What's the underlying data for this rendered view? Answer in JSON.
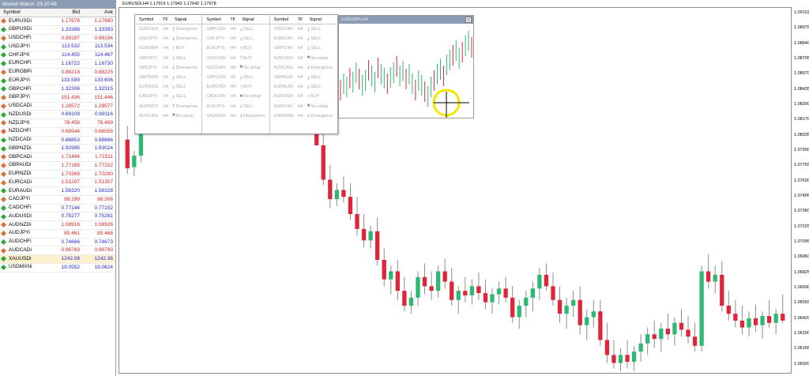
{
  "market_watch": {
    "title": "Market Watch: 23:20:49",
    "headers": {
      "symbol": "Symbol",
      "bid": "Bid",
      "ask": "Ask"
    },
    "rows": [
      {
        "symbol": "EURUSDi",
        "bid": "1.17678",
        "ask": "1.17680",
        "dir": "dn"
      },
      {
        "symbol": "GBPUSDi",
        "bid": "1.33388",
        "ask": "1.33393",
        "dir": "up"
      },
      {
        "symbol": "USDCHFi",
        "bid": "0.99187",
        "ask": "0.99194",
        "dir": "dn"
      },
      {
        "symbol": "USDJPYi",
        "bid": "113.532",
        "ask": "113.534",
        "dir": "up"
      },
      {
        "symbol": "CHFJPYi",
        "bid": "114.455",
        "ask": "114.467",
        "dir": "up"
      },
      {
        "symbol": "EURCHFi",
        "bid": "1.16722",
        "ask": "1.16730",
        "dir": "up"
      },
      {
        "symbol": "EURGBPi",
        "bid": "0.88218",
        "ask": "0.88225",
        "dir": "dn"
      },
      {
        "symbol": "EURJPYi",
        "bid": "133.599",
        "ask": "133.606",
        "dir": "up"
      },
      {
        "symbol": "GBPCHFi",
        "bid": "1.32306",
        "ask": "1.32315",
        "dir": "up"
      },
      {
        "symbol": "GBPJPYi",
        "bid": "151.436",
        "ask": "151.446",
        "dir": "dn"
      },
      {
        "symbol": "USDCADi",
        "bid": "1.28572",
        "ask": "1.28577",
        "dir": "dn"
      },
      {
        "symbol": "NZDUSDi",
        "bid": "0.69109",
        "ask": "0.69116",
        "dir": "up"
      },
      {
        "symbol": "NZDJPYi",
        "bid": "78.458",
        "ask": "78.469",
        "dir": "dn"
      },
      {
        "symbol": "NZDCHFi",
        "bid": "0.68544",
        "ask": "0.68556",
        "dir": "dn"
      },
      {
        "symbol": "NZDCADi",
        "bid": "0.88853",
        "ask": "0.88866",
        "dir": "up"
      },
      {
        "symbol": "GBPNZDi",
        "bid": "1.92995",
        "ask": "1.93024",
        "dir": "up"
      },
      {
        "symbol": "GBPCADi",
        "bid": "1.71494",
        "ask": "1.71511",
        "dir": "dn"
      },
      {
        "symbol": "GBPAUDi",
        "bid": "1.77185",
        "ask": "1.77202",
        "dir": "dn"
      },
      {
        "symbol": "EURNZDi",
        "bid": "1.70269",
        "ask": "1.70290",
        "dir": "dn"
      },
      {
        "symbol": "EURCADi",
        "bid": "1.51297",
        "ask": "1.51307",
        "dir": "dn"
      },
      {
        "symbol": "EURAUDi",
        "bid": "1.56320",
        "ask": "1.56328",
        "dir": "up"
      },
      {
        "symbol": "CADJPYi",
        "bid": "88.299",
        "ask": "88.306",
        "dir": "dn"
      },
      {
        "symbol": "CADCHFi",
        "bid": "0.77144",
        "ask": "0.77152",
        "dir": "up"
      },
      {
        "symbol": "AUDUSDi",
        "bid": "0.75277",
        "ask": "0.75281",
        "dir": "up"
      },
      {
        "symbol": "AUDNZDi",
        "bid": "1.08916",
        "ask": "1.08926",
        "dir": "dn"
      },
      {
        "symbol": "AUDJPYi",
        "bid": "85.461",
        "ask": "85.468",
        "dir": "dn"
      },
      {
        "symbol": "AUDCHFi",
        "bid": "0.74666",
        "ask": "0.74673",
        "dir": "up"
      },
      {
        "symbol": "AUDCADi",
        "bid": "0.96783",
        "ask": "0.96793",
        "dir": "dn"
      },
      {
        "symbol": "XAUUSDi",
        "bid": "1242.08",
        "ask": "1242.36",
        "dir": "up",
        "selected": true
      },
      {
        "symbol": "USDMXNi",
        "bid": "19.0552",
        "ask": "19.0624",
        "dir": "up"
      }
    ]
  },
  "chart": {
    "title": "EURUSDi,H4  1.17919 1.17942 1.17642 1.17678",
    "price_ticks": [
      "1.09110",
      "1.08975",
      "1.08840",
      "1.08705",
      "1.08570",
      "1.08435",
      "1.08300",
      "1.08170",
      "1.08035",
      "1.07900",
      "1.07765",
      "1.07630",
      "1.07495",
      "1.07360",
      "1.07225",
      "1.07095",
      "1.06960",
      "1.06825",
      "1.06690",
      "1.06555",
      "1.06420",
      "1.06290",
      "1.06155",
      "1.06020"
    ],
    "colors": {
      "bull": "#2db974",
      "bear": "#e0243a",
      "wick": "#8c8c8c"
    }
  },
  "chart_data": {
    "type": "candlestick",
    "title": "EURUSDi,H4",
    "ylim": [
      1.0595,
      1.0915
    ],
    "candles": [
      [
        1.08,
        1.0812,
        1.077,
        1.0775
      ],
      [
        1.0776,
        1.079,
        1.0768,
        1.0786
      ],
      [
        1.0786,
        1.0815,
        1.078,
        1.081
      ],
      [
        1.081,
        1.0832,
        1.0805,
        1.0828
      ],
      [
        1.0828,
        1.084,
        1.0815,
        1.082
      ],
      [
        1.082,
        1.0838,
        1.0812,
        1.0833
      ],
      [
        1.0833,
        1.0845,
        1.0825,
        1.083
      ],
      [
        1.083,
        1.085,
        1.0826,
        1.0842
      ],
      [
        1.0842,
        1.0855,
        1.083,
        1.0836
      ],
      [
        1.0836,
        1.0848,
        1.082,
        1.0824
      ],
      [
        1.0824,
        1.084,
        1.0815,
        1.0832
      ],
      [
        1.0832,
        1.0845,
        1.0822,
        1.0826
      ],
      [
        1.0826,
        1.0842,
        1.0818,
        1.0836
      ],
      [
        1.0836,
        1.085,
        1.0828,
        1.0845
      ],
      [
        1.0845,
        1.0852,
        1.083,
        1.0834
      ],
      [
        1.0834,
        1.0846,
        1.0824,
        1.084
      ],
      [
        1.084,
        1.0854,
        1.0832,
        1.0838
      ],
      [
        1.0838,
        1.0848,
        1.0826,
        1.083
      ],
      [
        1.083,
        1.0842,
        1.082,
        1.0836
      ],
      [
        1.0836,
        1.085,
        1.0828,
        1.0846
      ],
      [
        1.0846,
        1.086,
        1.0836,
        1.0842
      ],
      [
        1.0842,
        1.0852,
        1.083,
        1.0834
      ],
      [
        1.0834,
        1.0846,
        1.0824,
        1.084
      ],
      [
        1.084,
        1.0855,
        1.0832,
        1.085
      ],
      [
        1.085,
        1.0865,
        1.0842,
        1.0856
      ],
      [
        1.0856,
        1.0868,
        1.0838,
        1.0842
      ],
      [
        1.0842,
        1.0852,
        1.083,
        1.0835
      ],
      [
        1.0835,
        1.0845,
        1.0825,
        1.084
      ],
      [
        1.084,
        1.0852,
        1.08,
        1.0795
      ],
      [
        1.0795,
        1.0805,
        1.076,
        1.0765
      ],
      [
        1.0765,
        1.0778,
        1.074,
        1.0748
      ],
      [
        1.0748,
        1.0762,
        1.0742,
        1.0756
      ],
      [
        1.0756,
        1.0768,
        1.0745,
        1.075
      ],
      [
        1.075,
        1.0762,
        1.073,
        1.0735
      ],
      [
        1.0735,
        1.075,
        1.0716,
        1.0722
      ],
      [
        1.0722,
        1.0735,
        1.0706,
        1.0712
      ],
      [
        1.0712,
        1.0725,
        1.0705,
        1.072
      ],
      [
        1.072,
        1.0732,
        1.069,
        1.0695
      ],
      [
        1.0695,
        1.0705,
        1.0672,
        1.0678
      ],
      [
        1.0678,
        1.069,
        1.0665,
        1.0685
      ],
      [
        1.0685,
        1.0695,
        1.066,
        1.0668
      ],
      [
        1.0668,
        1.068,
        1.065,
        1.0655
      ],
      [
        1.0655,
        1.0668,
        1.0648,
        1.0662
      ],
      [
        1.0662,
        1.0685,
        1.0655,
        1.068
      ],
      [
        1.068,
        1.0692,
        1.0665,
        1.0672
      ],
      [
        1.0672,
        1.0685,
        1.066,
        1.0668
      ],
      [
        1.0668,
        1.069,
        1.0662,
        1.0685
      ],
      [
        1.0685,
        1.0696,
        1.067,
        1.0676
      ],
      [
        1.0676,
        1.0688,
        1.0655,
        1.066
      ],
      [
        1.066,
        1.0672,
        1.0648,
        1.0668
      ],
      [
        1.0668,
        1.068,
        1.0658,
        1.0664
      ],
      [
        1.0664,
        1.0678,
        1.0656,
        1.0672
      ],
      [
        1.0672,
        1.0684,
        1.066,
        1.0666
      ],
      [
        1.0666,
        1.0678,
        1.0652,
        1.0658
      ],
      [
        1.0658,
        1.067,
        1.0648,
        1.0665
      ],
      [
        1.0665,
        1.0676,
        1.0656,
        1.067
      ],
      [
        1.067,
        1.068,
        1.0658,
        1.0662
      ],
      [
        1.0662,
        1.0672,
        1.064,
        1.0645
      ],
      [
        1.0645,
        1.066,
        1.0635,
        1.0655
      ],
      [
        1.0655,
        1.0668,
        1.0645,
        1.0662
      ],
      [
        1.0662,
        1.0676,
        1.065,
        1.067
      ],
      [
        1.067,
        1.0688,
        1.066,
        1.0682
      ],
      [
        1.0682,
        1.0692,
        1.0668,
        1.0672
      ],
      [
        1.0672,
        1.0684,
        1.0655,
        1.066
      ],
      [
        1.066,
        1.0672,
        1.064,
        1.0648
      ],
      [
        1.0648,
        1.0662,
        1.0635,
        1.0655
      ],
      [
        1.0655,
        1.0668,
        1.0645,
        1.066
      ],
      [
        1.066,
        1.0672,
        1.063,
        1.0638
      ],
      [
        1.0638,
        1.0652,
        1.0625,
        1.0645
      ],
      [
        1.0645,
        1.066,
        1.0636,
        1.065
      ],
      [
        1.065,
        1.066,
        1.062,
        1.0625
      ],
      [
        1.0625,
        1.064,
        1.0605,
        1.0612
      ],
      [
        1.0612,
        1.0625,
        1.06,
        1.0605
      ],
      [
        1.0605,
        1.0618,
        1.0598,
        1.0612
      ],
      [
        1.0612,
        1.0625,
        1.06,
        1.0606
      ],
      [
        1.0606,
        1.062,
        1.0598,
        1.0615
      ],
      [
        1.0615,
        1.063,
        1.0606,
        1.0622
      ],
      [
        1.0622,
        1.0636,
        1.0612,
        1.063
      ],
      [
        1.063,
        1.0642,
        1.0618,
        1.0626
      ],
      [
        1.0626,
        1.064,
        1.0615,
        1.0635
      ],
      [
        1.0635,
        1.0648,
        1.0625,
        1.063
      ],
      [
        1.063,
        1.0645,
        1.062,
        1.064
      ],
      [
        1.064,
        1.0652,
        1.0628,
        1.0634
      ],
      [
        1.0634,
        1.0646,
        1.0622,
        1.0628
      ],
      [
        1.0628,
        1.064,
        1.0615,
        1.062
      ],
      [
        1.062,
        1.069,
        1.0615,
        1.0685
      ],
      [
        1.0685,
        1.07,
        1.067,
        1.0676
      ],
      [
        1.0676,
        1.069,
        1.0666,
        1.0682
      ],
      [
        1.0682,
        1.0694,
        1.065,
        1.0655
      ],
      [
        1.0655,
        1.0668,
        1.0642,
        1.0648
      ],
      [
        1.0648,
        1.066,
        1.0636,
        1.0642
      ],
      [
        1.0642,
        1.0655,
        1.063,
        1.0636
      ],
      [
        1.0636,
        1.065,
        1.0628,
        1.0644
      ],
      [
        1.0644,
        1.0656,
        1.0632,
        1.0638
      ],
      [
        1.0638,
        1.065,
        1.0626,
        1.0646
      ],
      [
        1.0646,
        1.066,
        1.0636,
        1.064
      ],
      [
        1.064,
        1.0652,
        1.063,
        1.0648
      ],
      [
        1.0648,
        1.0665,
        1.064,
        1.0642
      ]
    ]
  },
  "signals": {
    "headers": {
      "symbol": "Symbol",
      "tf": "TF",
      "signal": "Signal"
    },
    "columns": [
      [
        {
          "symbol": "EURUSDi",
          "tf": "H4",
          "arrow": "up-b",
          "signal": "Divergence"
        },
        {
          "symbol": "USDJPYi",
          "tf": "H4",
          "arrow": "dn-b",
          "signal": "Divergence"
        },
        {
          "symbol": "EURGBPi",
          "tf": "H4",
          "arrow": "up-g",
          "signal": "BUY"
        },
        {
          "symbol": "GBPJPYi",
          "tf": "H4",
          "arrow": "dn-r",
          "signal": "SELL"
        },
        {
          "symbol": "NZDJPYi",
          "tf": "H4",
          "arrow": "dn-b",
          "signal": "Divergence"
        },
        {
          "symbol": "GBPNZDi",
          "tf": "H4",
          "arrow": "dn-r",
          "signal": "SELL"
        },
        {
          "symbol": "EURNZDi",
          "tf": "H4",
          "arrow": "dn-r",
          "signal": "SELL"
        },
        {
          "symbol": "CADJPYi",
          "tf": "H4",
          "arrow": "dn-r",
          "signal": "SELL"
        },
        {
          "symbol": "AUDNZDi",
          "tf": "H4",
          "arrow": "up-b",
          "signal": "Divergence"
        },
        {
          "symbol": "AUDCADi",
          "tf": "H4",
          "arrow": "sq",
          "signal": "No setup"
        }
      ],
      [
        {
          "symbol": "GBPUSDi",
          "tf": "H4",
          "arrow": "dn-r",
          "signal": "SELL"
        },
        {
          "symbol": "CHFJPYi",
          "tf": "H4",
          "arrow": "dn-r",
          "signal": "SELL"
        },
        {
          "symbol": "EURJPYi",
          "tf": "H4",
          "arrow": "up-g",
          "signal": "BUY"
        },
        {
          "symbol": "USDCADi",
          "tf": "H4",
          "arrow": "up-g",
          "signal": "BUY"
        },
        {
          "symbol": "NZDCHFi",
          "tf": "H4",
          "arrow": "sq",
          "signal": "No setup"
        },
        {
          "symbol": "GBPCADi",
          "tf": "H4",
          "arrow": "dn-r",
          "signal": "SELL"
        },
        {
          "symbol": "EURCADi",
          "tf": "H4",
          "arrow": "up-g",
          "signal": "BUY"
        },
        {
          "symbol": "CADCHFi",
          "tf": "H4",
          "arrow": "sq",
          "signal": "No setup"
        },
        {
          "symbol": "AUDJPYi",
          "tf": "H4",
          "arrow": "dn-r",
          "signal": "SELL"
        },
        {
          "symbol": "XAUUSDi",
          "tf": "H4",
          "arrow": "dn-b",
          "signal": "Divergence"
        }
      ],
      [
        {
          "symbol": "USDCHFi",
          "tf": "H4",
          "arrow": "dn-r",
          "signal": "SELL"
        },
        {
          "symbol": "EURCHFi",
          "tf": "H4",
          "arrow": "dn-r",
          "signal": "SELL"
        },
        {
          "symbol": "GBPCHFi",
          "tf": "H4",
          "arrow": "dn-r",
          "signal": "SELL"
        },
        {
          "symbol": "NZDUSDi",
          "tf": "H4",
          "arrow": "sq",
          "signal": "No setup"
        },
        {
          "symbol": "NZDCADi",
          "tf": "H4",
          "arrow": "dn-b",
          "signal": "Divergence"
        },
        {
          "symbol": "GBPAUDi",
          "tf": "H4",
          "arrow": "dn-r",
          "signal": "SELL"
        },
        {
          "symbol": "EURAUDi",
          "tf": "H4",
          "arrow": "dn-r",
          "signal": "SELL"
        },
        {
          "symbol": "AUDUSDi",
          "tf": "H4",
          "arrow": "up-g",
          "signal": "BUY"
        },
        {
          "symbol": "AUDCHFi",
          "tf": "H4",
          "arrow": "sq",
          "signal": "No setup"
        },
        {
          "symbol": "USDMXNi",
          "tf": "H4",
          "arrow": "dn-b",
          "signal": "Divergence"
        }
      ]
    ]
  },
  "mini_chart": {
    "title": "EURGBPi,H4",
    "close_label": "X",
    "highlight_color": "#f5e600"
  }
}
